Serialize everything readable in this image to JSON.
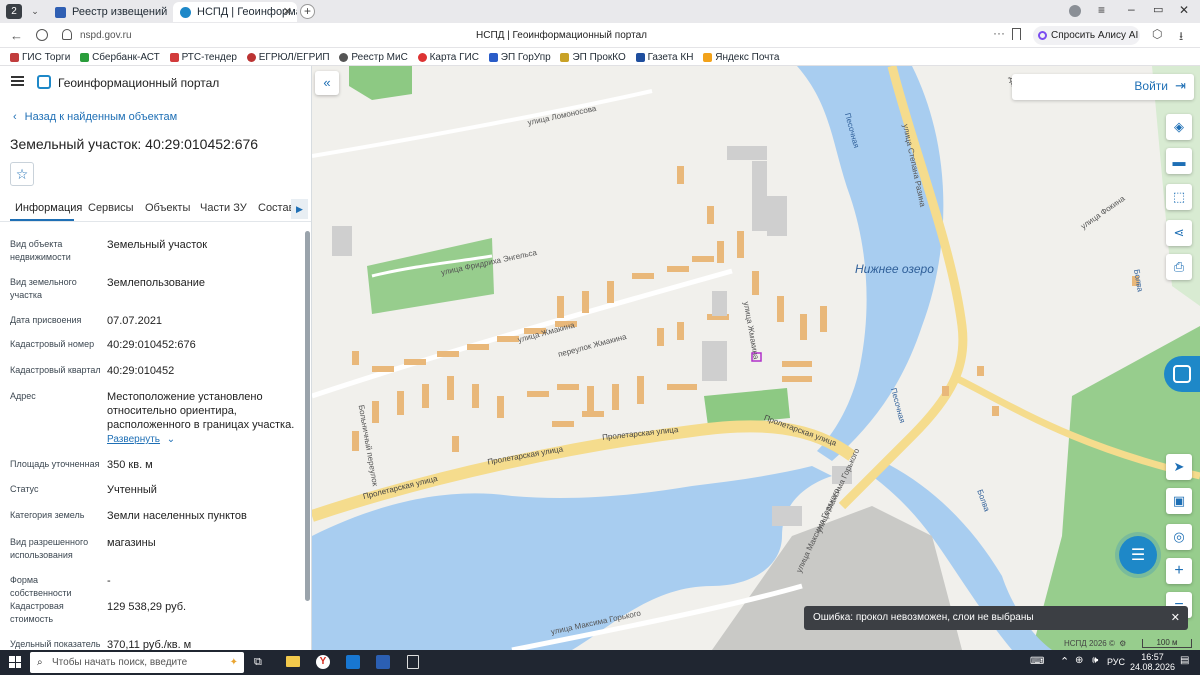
{
  "browser": {
    "tab_count": "2",
    "tabs": [
      {
        "title": "Реестр извещений"
      },
      {
        "title": "НСПД | Геоинформаци"
      }
    ],
    "url": "nspd.gov.ru",
    "page_title": "НСПД | Геоинформационный портал",
    "alice": "Спросить Алису AI",
    "bookmarks": [
      "ГИС Торги",
      "Сбербанк-АСТ",
      "РТС-тендер",
      "ЕГРЮЛ/ЕГРИП",
      "Реестр МиС",
      "Карта ГИС",
      "ЭП ГорУпр",
      "ЭП ПрокКО",
      "Газета КН",
      "Яндекс Почта"
    ]
  },
  "portal": {
    "title": "Геоинформационный портал"
  },
  "panel": {
    "back": "Назад к найденным объектам",
    "object_title": "Земельный участок: 40:29:010452:676",
    "tabs": [
      "Информация",
      "Сервисы",
      "Объекты",
      "Части ЗУ",
      "Состав"
    ],
    "fields": [
      {
        "key": "Вид объекта недвижимости",
        "value": "Земельный участок"
      },
      {
        "key": "Вид земельного участка",
        "value": "Землепользование"
      },
      {
        "key": "Дата присвоения",
        "value": "07.07.2021"
      },
      {
        "key": "Кадастровый номер",
        "value": "40:29:010452:676"
      },
      {
        "key": "Кадастровый квартал",
        "value": "40:29:010452"
      },
      {
        "key": "Адрес",
        "value": "Местоположение установлено относительно ориентира, расположенного в границах участка."
      },
      {
        "key": "Площадь уточненная",
        "value": "350 кв. м"
      },
      {
        "key": "Статус",
        "value": "Учтенный"
      },
      {
        "key": "Категория земель",
        "value": "Земли населенных пунктов"
      },
      {
        "key": "Вид разрешенного использования",
        "value": "магазины"
      },
      {
        "key": "Форма собственности",
        "value": "-"
      },
      {
        "key": "Кадастровая стоимость",
        "value": "129 538,29 руб."
      },
      {
        "key": "Удельный показатель",
        "value": "370,11 руб./кв. м"
      }
    ],
    "expand": "Развернуть"
  },
  "map": {
    "login": "Войти",
    "labels": {
      "lomonosova": "улица Ломоносова",
      "engelsa": "улица Фридриха Энгельса",
      "zhmakina": "улица Жмакина",
      "zhmakina_lane": "переулок Жмакина",
      "zhmakina_v": "улица Жмакина",
      "lake": "Нижнее озеро",
      "razina": "улица Степана Разина",
      "fokina": "улица Фокина",
      "proletarskaya1": "Пролетарская улица",
      "proletarskaya2": "Пролетарская улица",
      "proletarskaya3": "Пролетарская улица",
      "proletarskaya4": "Пролетарская улица",
      "gorkogo1": "улица Максима Горького",
      "gorkogo2": "улица Максима Горького",
      "gorkogo3": "улица Максима Горького",
      "bolnichny": "Больничный переулок",
      "pesochnaya1": "Песочная",
      "pesochnaya2": "Песочная",
      "bolva1": "Болва",
      "bolva2": "Болва",
      "dach": "Дачн"
    },
    "error": "Ошибка: прокол невозможен, слои не выбраны",
    "copyright": "НСПД 2026 ©",
    "scale": "100 м"
  },
  "taskbar": {
    "search": "Чтобы начать поиск, введите",
    "lang": "РУС",
    "time": "16:57",
    "date": "24.08.2026"
  }
}
